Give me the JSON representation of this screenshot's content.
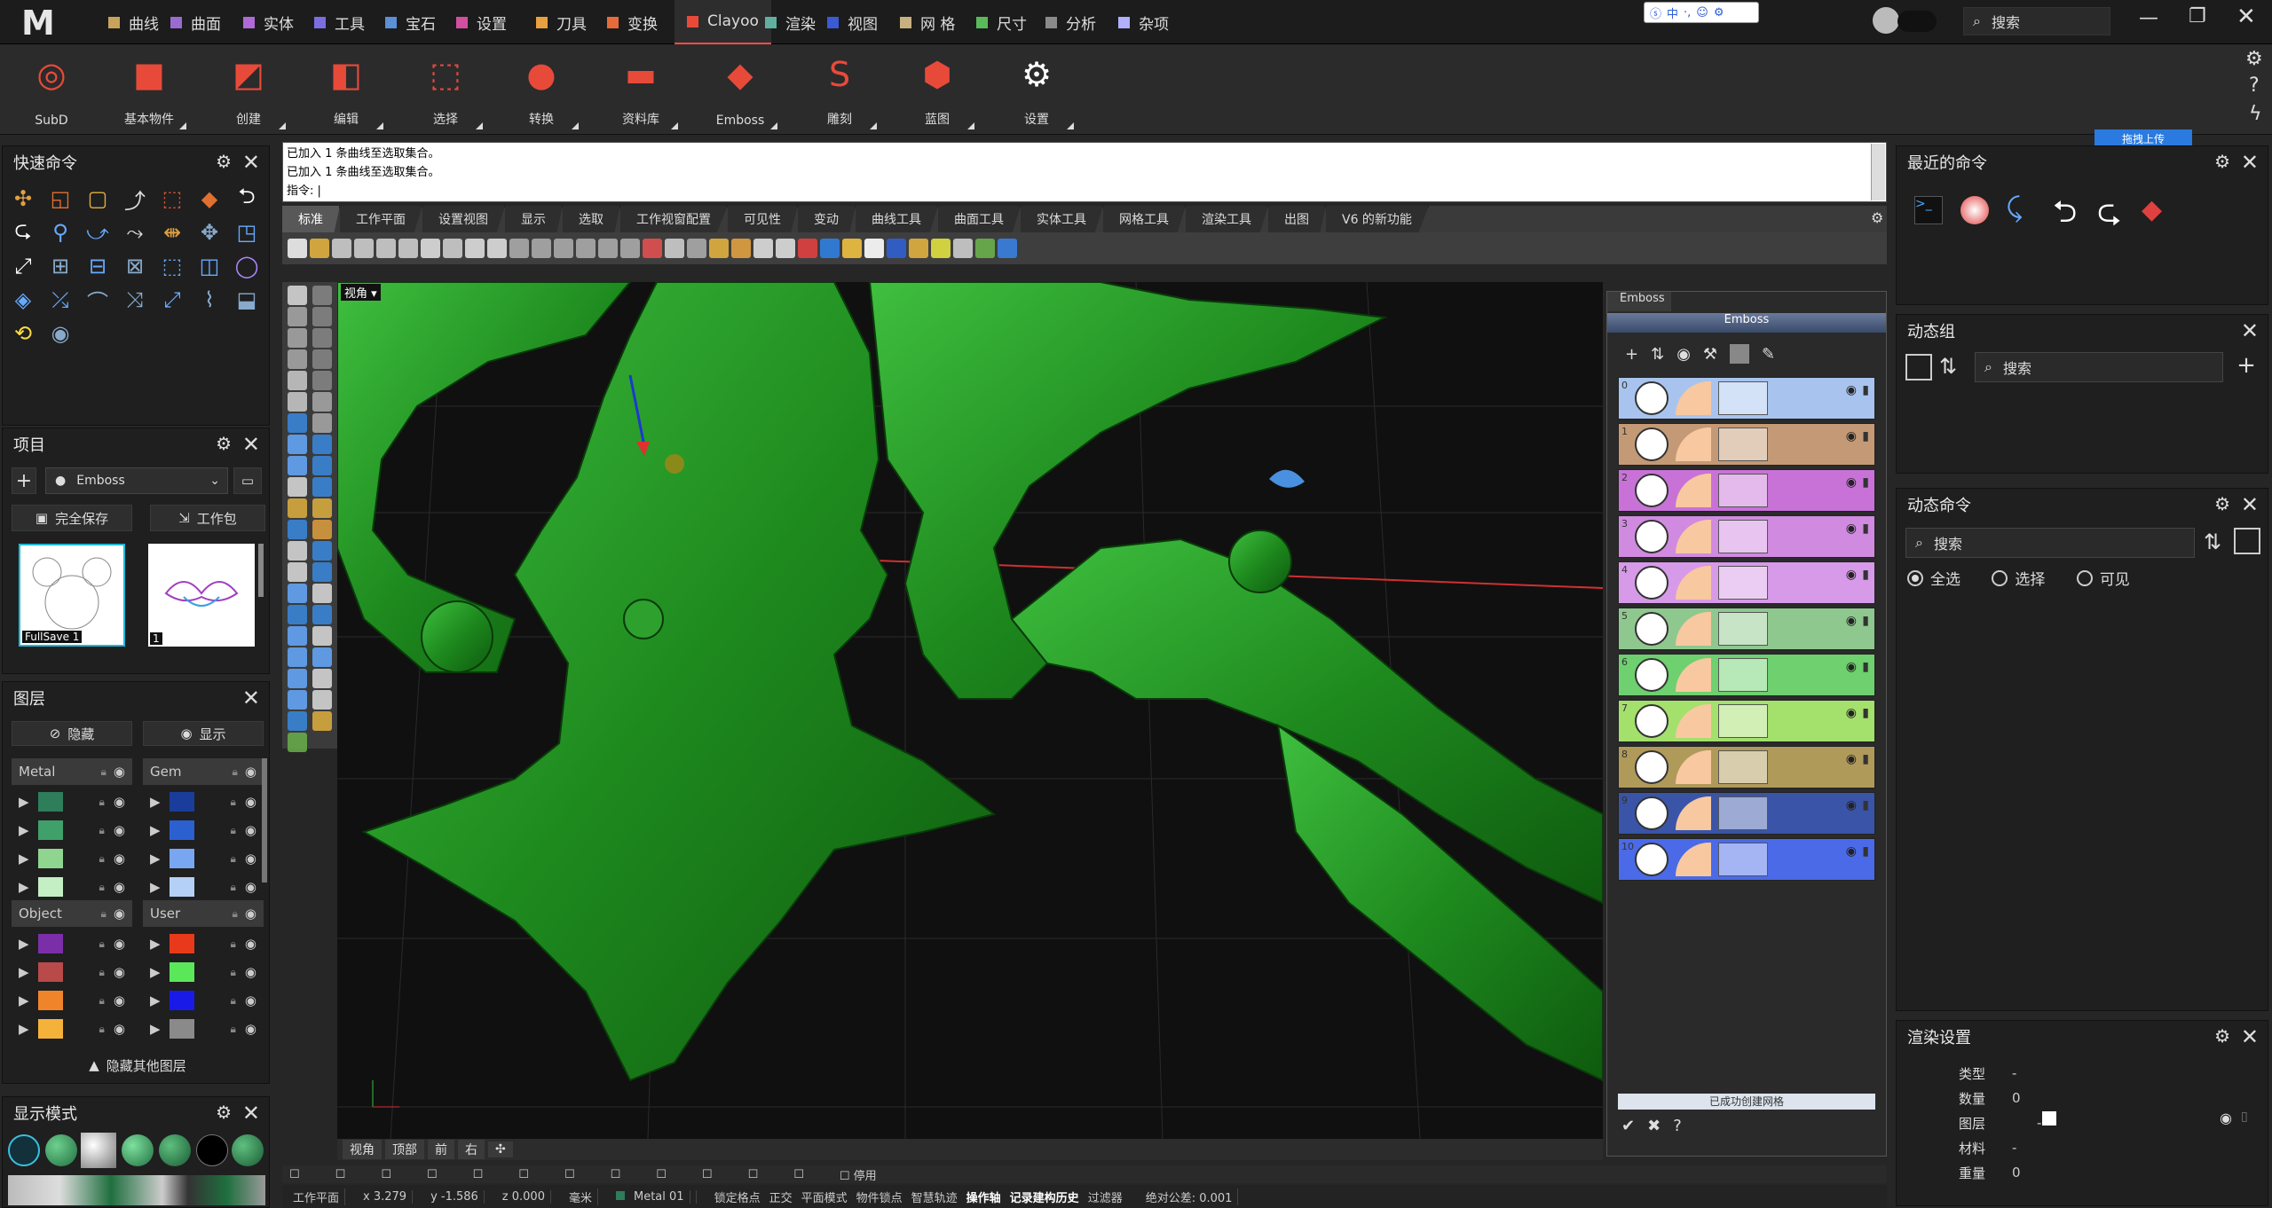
{
  "app": {
    "logo": "M",
    "search_placeholder": "搜索",
    "window_controls": [
      "minimize",
      "restore",
      "close"
    ]
  },
  "menu_tabs": [
    {
      "label": "曲线",
      "color": "#c8a45a"
    },
    {
      "label": "曲面",
      "color": "#9a6bd1"
    },
    {
      "label": "实体",
      "color": "#b06ad6"
    },
    {
      "label": "工具",
      "color": "#7a6ee0"
    },
    {
      "label": "宝石",
      "color": "#5b8fd6"
    },
    {
      "label": "设置",
      "color": "#d24fa0"
    },
    {
      "label": "刀具",
      "color": "#e8a040"
    },
    {
      "label": "变换",
      "color": "#e86a3a"
    },
    {
      "label": "Clayoo",
      "color": "#e84a3a"
    },
    {
      "label": "渲染",
      "color": "#5fb0a0"
    },
    {
      "label": "视图",
      "color": "#3a5ad6"
    },
    {
      "label": "网 格",
      "color": "#c8b080"
    },
    {
      "label": "尺寸",
      "color": "#5aba5a"
    },
    {
      "label": "分析",
      "color": "#8a8a8a"
    },
    {
      "label": "杂项",
      "color": "#b0b0ff"
    }
  ],
  "ime_bar": "中",
  "ribbon": [
    {
      "label": "SubD",
      "icon": "subd-icon"
    },
    {
      "label": "基本物件",
      "icon": "cube-icon"
    },
    {
      "label": "创建",
      "icon": "create-icon"
    },
    {
      "label": "编辑",
      "icon": "edit-icon"
    },
    {
      "label": "选择",
      "icon": "select-icon"
    },
    {
      "label": "转换",
      "icon": "convert-icon"
    },
    {
      "label": "资料库",
      "icon": "folder-icon"
    },
    {
      "label": "Emboss",
      "icon": "emboss-icon"
    },
    {
      "label": "雕刻",
      "icon": "sculpt-icon"
    },
    {
      "label": "蓝图",
      "icon": "blueprint-icon"
    },
    {
      "label": "设置",
      "icon": "gear-icon"
    }
  ],
  "quick_commands": {
    "title": "快速命令"
  },
  "project": {
    "title": "项目",
    "dropdown": "Emboss",
    "save_btn": "完全保存",
    "package_btn": "工作包",
    "thumbs": [
      {
        "label": "FullSave 1"
      },
      {
        "label": "1"
      }
    ]
  },
  "layers": {
    "title": "图层",
    "hide_btn": "隐藏",
    "show_btn": "显示",
    "groups": [
      {
        "name": "Metal",
        "colors": [
          "#2e7d5b",
          "#3fa06a",
          "#8fd48f",
          "#c4eec4"
        ]
      },
      {
        "name": "Gem",
        "colors": [
          "#1a3c9a",
          "#2a60d0",
          "#79a6f0",
          "#b4d0f7"
        ]
      },
      {
        "name": "Object",
        "colors": [
          "#7a2fa8",
          "#b84a4a",
          "#f0842a",
          "#f5b23a"
        ]
      },
      {
        "name": "User",
        "colors": [
          "#e83a1a",
          "#5ae85a",
          "#1a1ae8",
          "#8a8a8a"
        ]
      }
    ],
    "hide_others": "隐藏其他图层"
  },
  "display_mode": {
    "title": "显示模式"
  },
  "command_history": [
    "已加入 1 条曲线至选取集合。",
    "已加入 1 条曲线至选取集合。"
  ],
  "command_prompt": "指令:",
  "toolbar_tabs": [
    "标准",
    "工作平面",
    "设置视图",
    "显示",
    "选取",
    "工作视窗配置",
    "可见性",
    "变动",
    "曲线工具",
    "曲面工具",
    "实体工具",
    "网格工具",
    "渲染工具",
    "出图",
    "V6 的新功能"
  ],
  "viewport": {
    "label": "视角",
    "tabs": [
      "视角",
      "顶部",
      "前",
      "右"
    ]
  },
  "emboss_panel": {
    "tab": "Emboss",
    "title": "Emboss",
    "status": "已成功创建网格",
    "layers": [
      {
        "index": "0",
        "color": "#a8c4ee"
      },
      {
        "index": "1",
        "color": "#c49a76"
      },
      {
        "index": "2",
        "color": "#c872d8"
      },
      {
        "index": "3",
        "color": "#d08ae0"
      },
      {
        "index": "4",
        "color": "#d69ae8"
      },
      {
        "index": "5",
        "color": "#8ec88e"
      },
      {
        "index": "6",
        "color": "#6ed06e"
      },
      {
        "index": "7",
        "color": "#a4e06c"
      },
      {
        "index": "8",
        "color": "#b09a5a"
      },
      {
        "index": "9",
        "color": "#3a54a8"
      },
      {
        "index": "10",
        "color": "#4a6ae8"
      }
    ]
  },
  "recent_commands": {
    "title": "最近的命令"
  },
  "dynamic_group": {
    "title": "动态组",
    "search": "搜索"
  },
  "dynamic_commands": {
    "title": "动态命令",
    "search": "搜索",
    "radios": [
      "全选",
      "选择",
      "可见"
    ]
  },
  "render_settings": {
    "title": "渲染设置",
    "rows": [
      {
        "label": "类型",
        "value": "-"
      },
      {
        "label": "数量",
        "value": "0"
      },
      {
        "label": "图层",
        "value": "-"
      },
      {
        "label": "材料",
        "value": "-"
      },
      {
        "label": "重量",
        "value": "0"
      }
    ]
  },
  "upload_badge": "拖拽上传",
  "snap_disable": "停用",
  "status": {
    "cplane": "工作平面",
    "x": "x 3.279",
    "y": "y -1.586",
    "z": "z 0.000",
    "unit": "毫米",
    "layer": "Metal 01",
    "toggles": [
      "锁定格点",
      "正交",
      "平面模式",
      "物件锁点",
      "智慧轨迹",
      "操作轴",
      "记录建构历史",
      "过滤器"
    ],
    "tolerance": "绝对公差: 0.001"
  }
}
